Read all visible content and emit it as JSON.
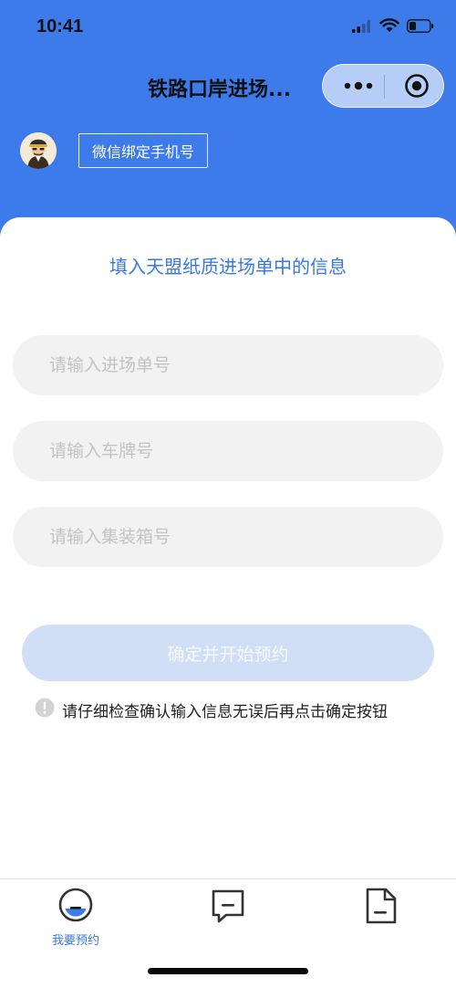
{
  "status_bar": {
    "time": "10:41"
  },
  "nav": {
    "title": "铁路口岸进场...",
    "more_icon": "more-dots-icon",
    "close_icon": "target-close-icon"
  },
  "profile": {
    "avatar_icon": "driver-avatar-icon",
    "bind_phone_label": "微信绑定手机号"
  },
  "form": {
    "title": "填入天盟纸质进场单中的信息",
    "entry_no": {
      "placeholder": "请输入进场单号",
      "value": ""
    },
    "plate_no": {
      "placeholder": "请输入车牌号",
      "value": ""
    },
    "container_no": {
      "placeholder": "请输入集装箱号",
      "value": ""
    },
    "confirm_label": "确定并开始预约",
    "hint": "请仔细检查确认输入信息无误后再点击确定按钮"
  },
  "tabs": [
    {
      "label": "我要预约",
      "icon": "reserve-icon",
      "active": true
    },
    {
      "label": "",
      "icon": "message-icon",
      "active": false
    },
    {
      "label": "",
      "icon": "document-icon",
      "active": false
    }
  ],
  "colors": {
    "primary": "#3d7bea",
    "accent_text": "#3a78e0",
    "disabled_button": "#d0dff5",
    "input_bg": "#f2f2f2"
  }
}
